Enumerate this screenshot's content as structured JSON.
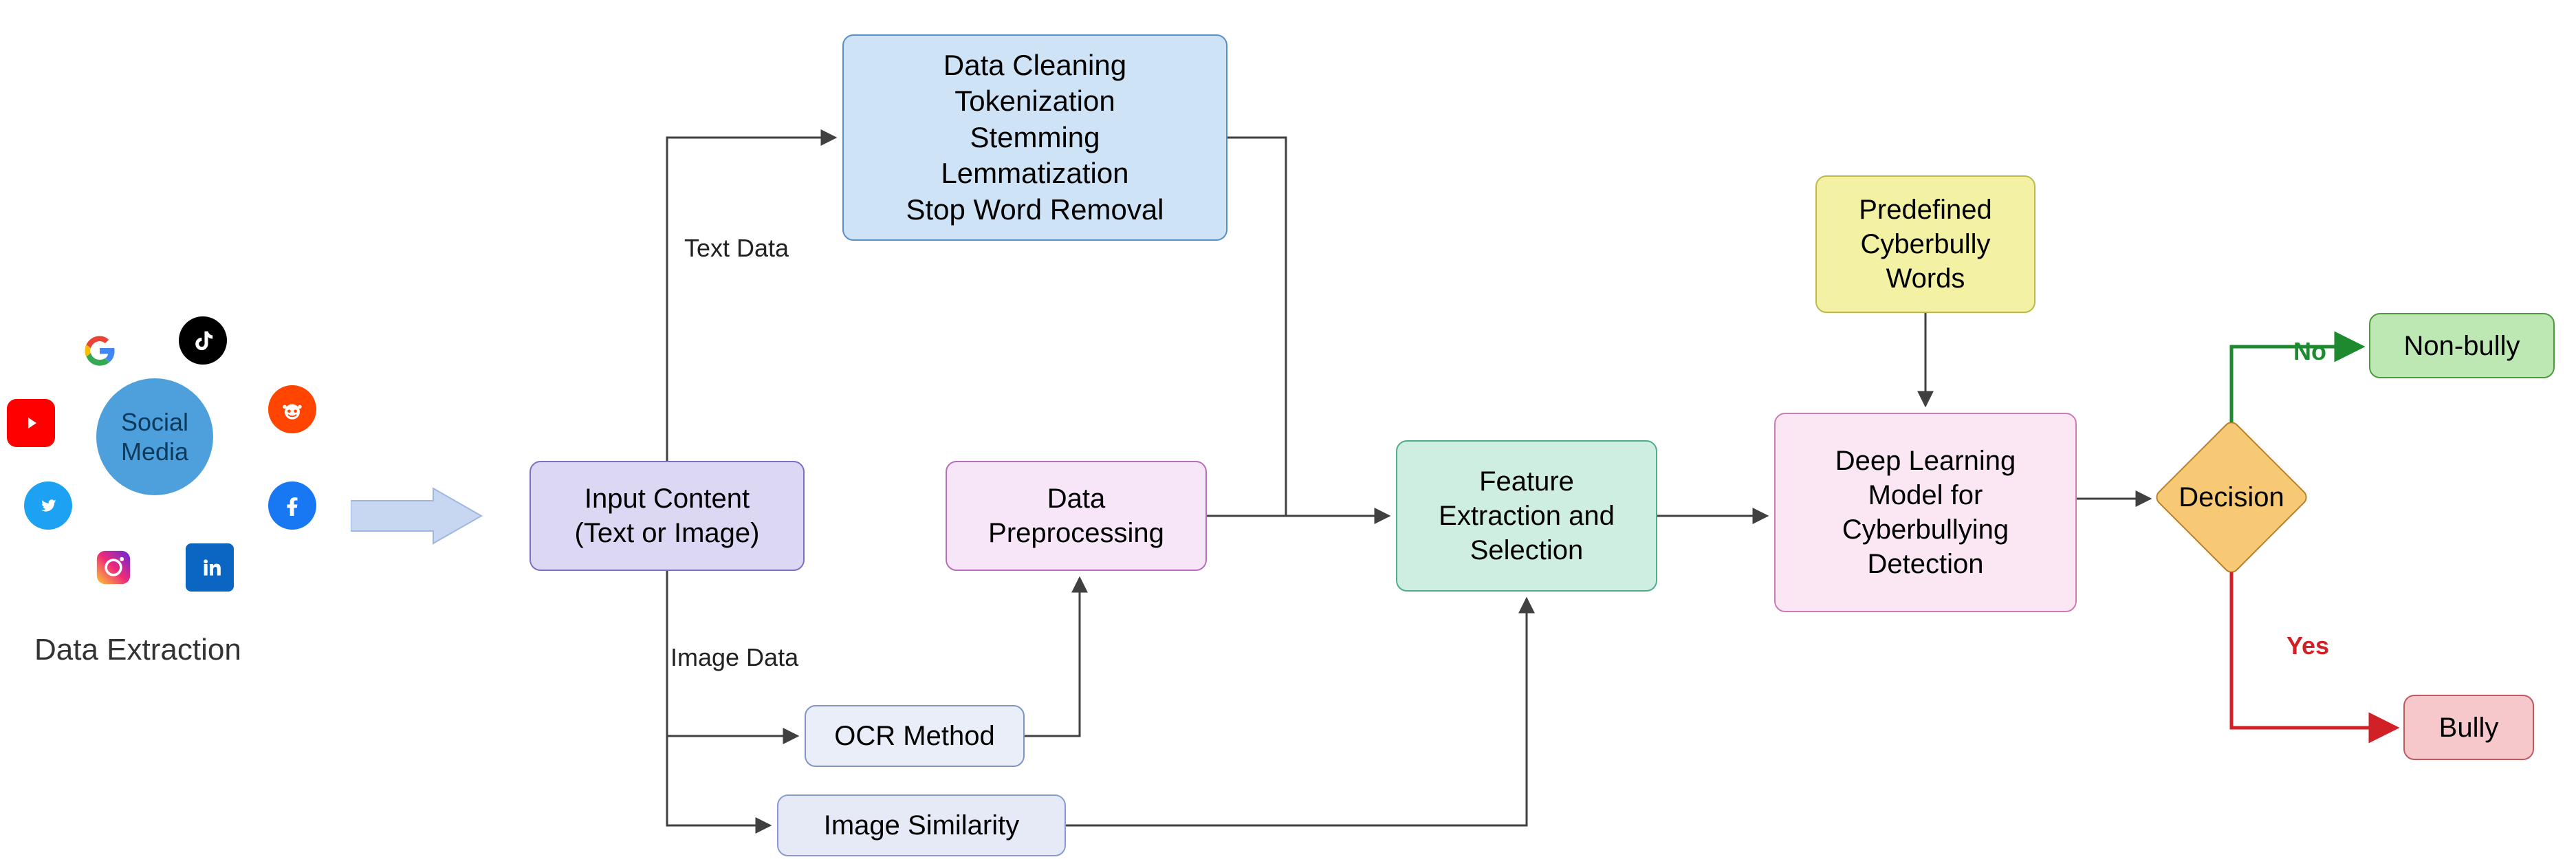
{
  "caption": "Data Extraction",
  "social_bubble": "Social Media",
  "nodes": {
    "input": "Input Content\n(Text or Image)",
    "preproc_list": "Data Cleaning\nTokenization\nStemming\nLemmatization\nStop Word Removal",
    "preproc_box": "Data\nPreprocessing",
    "ocr": "OCR Method",
    "imgsim": "Image Similarity",
    "feat": "Feature\nExtraction and\nSelection",
    "known_words": "Predefined\nCyberbully\nWords",
    "dl": "Deep Learning\nModel for\nCyberbullying\nDetection",
    "decision": "Decision",
    "nonbully": "Non-bully",
    "bully": "Bully"
  },
  "edge": {
    "text": "Text Data",
    "image": "Image Data"
  },
  "branch": {
    "no": "No",
    "yes": "Yes"
  },
  "colors": {
    "input_bg": "#dcd8f4",
    "input_br": "#7d6fc4",
    "list_bg": "#cfe3f7",
    "list_br": "#5a8ec7",
    "pp_bg": "#f6e6f8",
    "pp_br": "#b66fb8",
    "ocr_bg": "#e9eef8",
    "ocr_br": "#7f95c6",
    "imgsim_bg": "#e6eaf7",
    "imgsim_br": "#8a9bd0",
    "feat_bg": "#cdeee0",
    "feat_br": "#4fae8a",
    "words_bg": "#f3f1a4",
    "words_br": "#bdb94a",
    "dl_bg": "#fbe7f4",
    "dl_br": "#c97db6",
    "diam_bg": "#f7c974",
    "diam_br": "#b8802a",
    "nonbully_bg": "#bde8b3",
    "nonbully_br": "#4d9a3d",
    "bully_bg": "#f6c8cb",
    "bully_br": "#c05a60",
    "green": "#1e8a2f",
    "red": "#d22027"
  }
}
